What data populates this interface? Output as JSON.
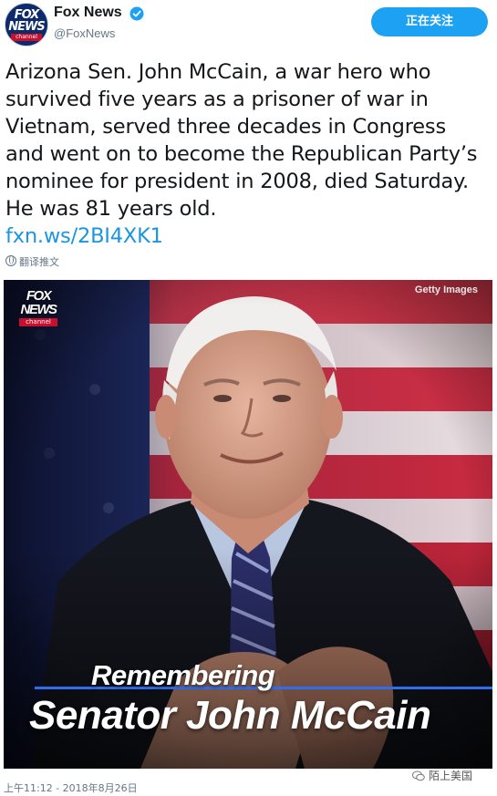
{
  "header": {
    "account_name": "Fox News",
    "handle": "@FoxNews",
    "follow_label": "正在关注",
    "avatar_logo": [
      "FOX",
      "NEWS",
      "channel"
    ]
  },
  "tweet": {
    "text": "Arizona Sen. John McCain, a war hero who survived five years as a prisoner of war in Vietnam, served three decades in Congress and went on to become the Republican Party’s nominee for president in 2008, died Saturday. He was 81 years old.",
    "link": "fxn.ws/2BI4XK1",
    "translate_label": "翻译推文"
  },
  "media": {
    "credit": "Getty Images",
    "watermark": [
      "FOX",
      "NEWS",
      "channel"
    ],
    "caption_line1": "Remembering",
    "caption_line2": "Senator John McCain"
  },
  "footer": {
    "timestamp": "上午11:12 - 2018年8月26日",
    "brand": "陌上美国"
  },
  "colors": {
    "accent": "#1da1f2",
    "link": "#1b95e0",
    "fox_red": "#c8102e",
    "fox_navy": "#0d2a6b"
  }
}
